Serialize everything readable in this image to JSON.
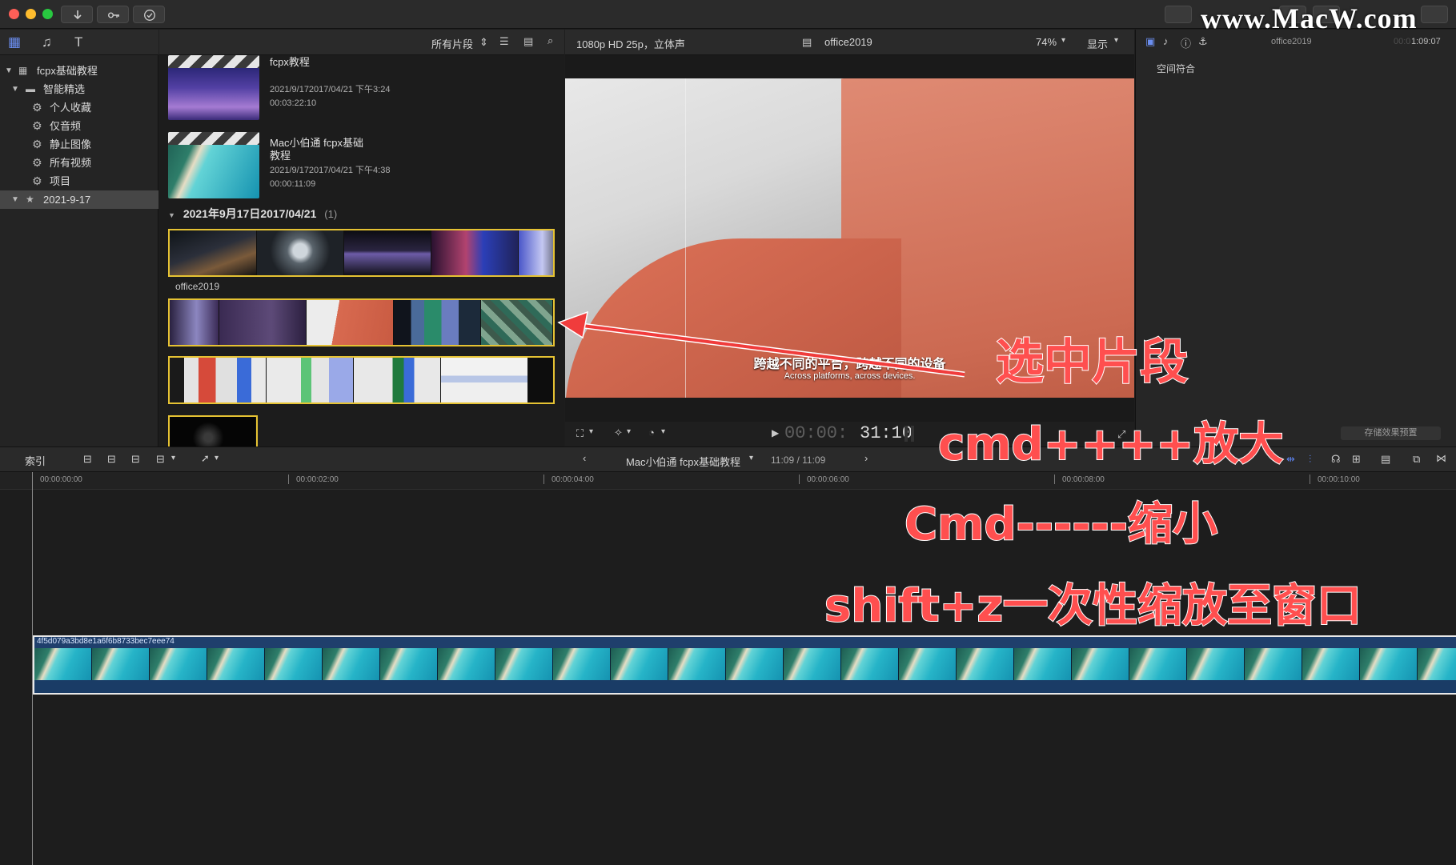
{
  "watermark": "www.MacW.com",
  "sidebar": {
    "items": [
      {
        "label": "fcpx基础教程"
      },
      {
        "label": "智能精选"
      },
      {
        "label": "个人收藏"
      },
      {
        "label": "仅音频"
      },
      {
        "label": "静止图像"
      },
      {
        "label": "所有视频"
      },
      {
        "label": "项目"
      },
      {
        "label": "2021-9-17"
      }
    ]
  },
  "browser": {
    "filter_label": "所有片段",
    "projects": [
      {
        "title": "fcpx教程",
        "date": "2021/9/172017/04/21 下午3:24",
        "duration": "00:03:22:10"
      },
      {
        "title_line1": "Mac小伯通 fcpx基础",
        "title_line2": "教程",
        "date": "2021/9/172017/04/21 下午4:38",
        "duration": "00:00:11:09"
      }
    ],
    "event_group": {
      "label": "2021年9月17日2017/04/21",
      "count": "(1)"
    },
    "clip_name": "office2019"
  },
  "viewer": {
    "format": "1080p HD 25p，立体声",
    "clip_title": "office2019",
    "zoom": "74%",
    "display_label": "显示",
    "subtitle_cn": "跨越不同的平台，跨越不同的设备",
    "subtitle_en": "Across platforms, across devices.",
    "timecode_dim": "00:00:",
    "timecode": "31:10"
  },
  "inspector": {
    "title": "office2019",
    "timecode_dim": "00:0",
    "timecode": "1:09:07",
    "section": "空间符合",
    "save_preset": "存储效果预置"
  },
  "timeline": {
    "index_label": "索引",
    "project_name": "Mac小伯通 fcpx基础教程",
    "position": "11:09 / 11:09",
    "ruler": [
      "00:00:00:00",
      "00:00:02:00",
      "00:00:04:00",
      "00:00:06:00",
      "00:00:08:00",
      "00:00:10:00"
    ],
    "clip_label": "4f5d079a3bd8e1a6f6b8733bec7eee74"
  },
  "annotations": {
    "select_clip": "选中片段",
    "zoom_in": "cmd++++放大",
    "zoom_out": "Cmd------缩小",
    "fit": "shift+z一次性缩放至窗口"
  },
  "colors": {
    "accent_blue": "#3d6bd6",
    "selection_yellow": "#e5c233",
    "annotation_red": "#ff4f4f",
    "clip_blue": "#1f3f6c"
  }
}
